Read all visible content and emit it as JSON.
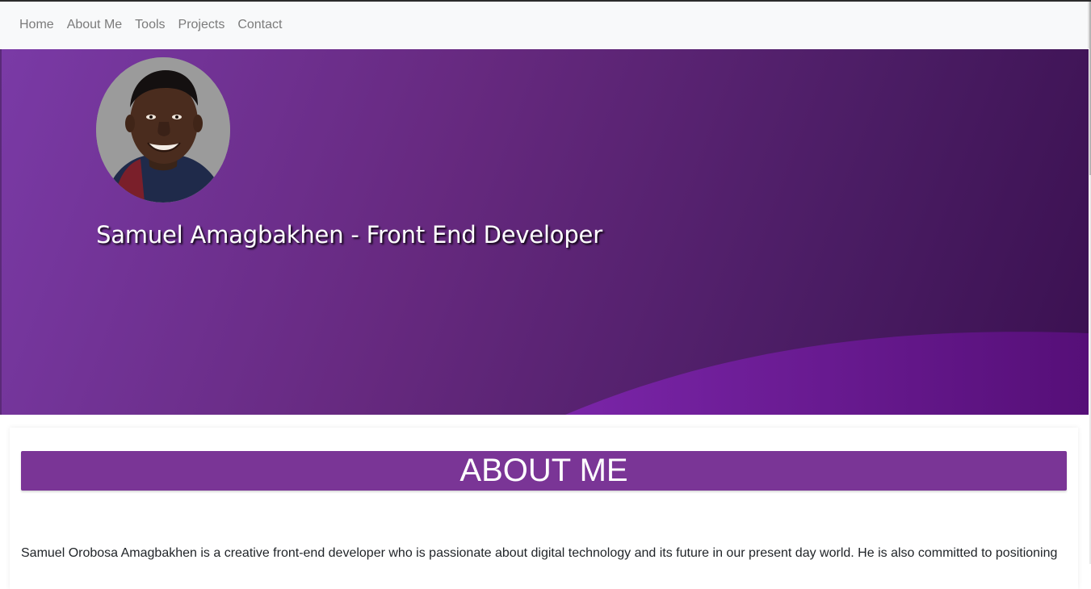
{
  "nav": {
    "items": [
      {
        "label": "Home"
      },
      {
        "label": "About Me"
      },
      {
        "label": "Tools"
      },
      {
        "label": "Projects"
      },
      {
        "label": "Contact"
      }
    ]
  },
  "hero": {
    "title": "Samuel Amagbakhen - Front End Developer",
    "avatar_icon": "profile-photo"
  },
  "about": {
    "heading": "ABOUT ME",
    "text": "Samuel Orobosa Amagbakhen is a creative front-end developer who is passionate about digital technology and its future in our present day world. He is also committed to positioning"
  },
  "colors": {
    "nav_bg": "#f8f9fa",
    "nav_text": "#7b7b7b",
    "hero_purple_light": "#7a3aa6",
    "hero_purple_dark": "#3a1050",
    "accent_purple": "#7a3596"
  }
}
